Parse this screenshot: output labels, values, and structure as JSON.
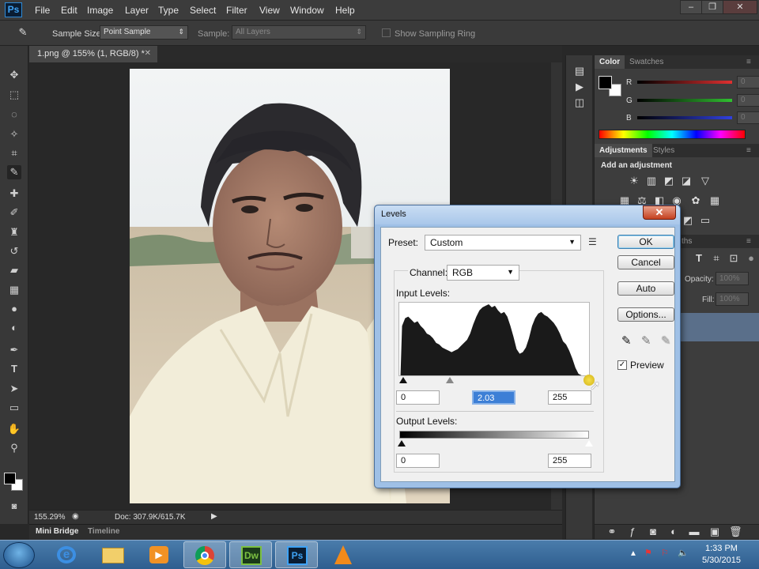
{
  "app": {
    "logo": "Ps",
    "menu": [
      "File",
      "Edit",
      "Image",
      "Layer",
      "Type",
      "Select",
      "Filter",
      "View",
      "Window",
      "Help"
    ],
    "window_controls": [
      "minimize-icon",
      "restore-icon",
      "close-icon"
    ]
  },
  "options_bar": {
    "sample_size_label": "Sample Size:",
    "sample_size_value": "Point Sample",
    "sample_label": "Sample:",
    "sample_value": "All Layers",
    "show_ring_label": "Show Sampling Ring"
  },
  "document": {
    "tab_title": "1.png @ 155% (1, RGB/8) *",
    "zoom": "155.29%",
    "doc_size": "Doc: 307.9K/615.7K"
  },
  "bottom_tabs": [
    "Mini Bridge",
    "Timeline"
  ],
  "color_panel": {
    "tabs": [
      "Color",
      "Swatches"
    ],
    "channels": [
      {
        "label": "R",
        "value": "0",
        "color": "#e03030"
      },
      {
        "label": "G",
        "value": "0",
        "color": "#30c030"
      },
      {
        "label": "B",
        "value": "0",
        "color": "#3040e0"
      }
    ]
  },
  "adjustments_panel": {
    "tabs": [
      "Adjustments",
      "Styles"
    ],
    "heading": "Add an adjustment"
  },
  "layers_panel": {
    "tab_partial": "ths",
    "opacity_label": "Opacity:",
    "opacity_value": "100%",
    "fill_label": "Fill:",
    "fill_value": "100%"
  },
  "levels": {
    "title": "Levels",
    "preset_label": "Preset:",
    "preset_value": "Custom",
    "channel_label": "Channel:",
    "channel_value": "RGB",
    "input_levels_label": "Input Levels:",
    "input_black": "0",
    "input_gamma": "2.03",
    "input_white": "255",
    "output_levels_label": "Output Levels:",
    "output_black": "0",
    "output_white": "255",
    "buttons": {
      "ok": "OK",
      "cancel": "Cancel",
      "auto": "Auto",
      "options": "Options..."
    },
    "preview_label": "Preview",
    "preview_checked": true
  },
  "taskbar": {
    "time": "1:33 PM",
    "date": "5/30/2015",
    "apps": [
      "internet-explorer",
      "file-explorer",
      "media-player",
      "chrome",
      "dreamweaver",
      "photoshop",
      "vlc"
    ],
    "dw_label": "Dw",
    "ps_label": "Ps"
  }
}
